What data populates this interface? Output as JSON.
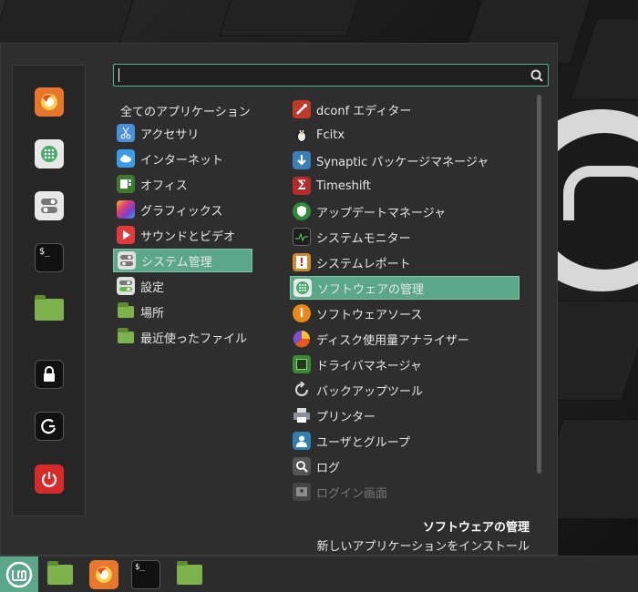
{
  "search": {
    "value": ""
  },
  "categories": {
    "all_label": "全てのアプリケーション",
    "items": [
      {
        "label": "アクセサリ",
        "icon": "scissors-icon",
        "color": "#4a90d9"
      },
      {
        "label": "インターネット",
        "icon": "cloud-icon",
        "color": "#3a9ee6"
      },
      {
        "label": "オフィス",
        "icon": "office-icon",
        "color": "#3d7a2f"
      },
      {
        "label": "グラフィックス",
        "icon": "graphics-icon",
        "color": "#c23f8f"
      },
      {
        "label": "サウンドとビデオ",
        "icon": "play-icon",
        "color": "#e03a3a"
      },
      {
        "label": "システム管理",
        "icon": "toggle-icon",
        "color": "#d8d8d8"
      },
      {
        "label": "設定",
        "icon": "settings-toggle-icon",
        "color": "#d8d8d8"
      },
      {
        "label": "場所",
        "icon": "folder-icon",
        "color": "#7eb24c"
      },
      {
        "label": "最近使ったファイル",
        "icon": "recent-folder-icon",
        "color": "#7eb24c"
      }
    ],
    "selected_index": 5
  },
  "apps": {
    "items": [
      {
        "label": "dconf エディター",
        "icon": "dconf-icon",
        "color": "#c0392b"
      },
      {
        "label": "Fcitx",
        "icon": "penguin-icon",
        "color": "#333333"
      },
      {
        "label": "Synaptic パッケージマネージャ",
        "icon": "download-arrow-icon",
        "color": "#3b7fb8"
      },
      {
        "label": "Timeshift",
        "icon": "timeshift-icon",
        "color": "#b52a2a"
      },
      {
        "label": "アップデートマネージャ",
        "icon": "shield-icon",
        "color": "#2f8a3a"
      },
      {
        "label": "システムモニター",
        "icon": "monitor-graph-icon",
        "color": "#1e1e1e"
      },
      {
        "label": "システムレポート",
        "icon": "alert-icon",
        "color": "#d08a2e"
      },
      {
        "label": "ソフトウェアの管理",
        "icon": "grid-icon",
        "color": "#59a86f"
      },
      {
        "label": "ソフトウェアソース",
        "icon": "info-icon",
        "color": "#e88a1a"
      },
      {
        "label": "ディスク使用量アナライザー",
        "icon": "pie-icon",
        "color": "#e85a1a"
      },
      {
        "label": "ドライバマネージャ",
        "icon": "chip-icon",
        "color": "#3b8a2f"
      },
      {
        "label": "バックアップツール",
        "icon": "backup-icon",
        "color": "#444444"
      },
      {
        "label": "プリンター",
        "icon": "printer-icon",
        "color": "#8b8f99"
      },
      {
        "label": "ユーザとグループ",
        "icon": "user-icon",
        "color": "#2f7fb0"
      },
      {
        "label": "ログ",
        "icon": "magnifier-icon",
        "color": "#555555"
      },
      {
        "label": "ログイン画面",
        "icon": "login-icon",
        "color": "#666666"
      }
    ],
    "selected_index": 7
  },
  "description": {
    "title": "ソフトウェアの管理",
    "text": "新しいアプリケーションをインストール"
  },
  "colors": {
    "accent": "#5aa889"
  }
}
